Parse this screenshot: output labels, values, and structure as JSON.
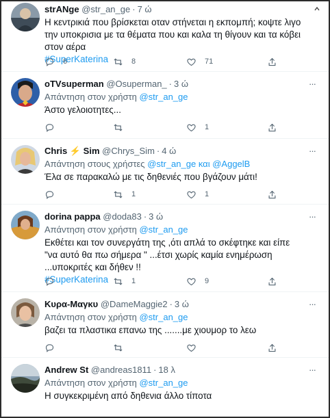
{
  "tweets": [
    {
      "name": "strANge",
      "handle": "@str_an_ge",
      "time": "7 ώ",
      "reply_prefix": "",
      "reply_mentions": [],
      "text": "Η κεντρικιά που βρίσκεται οταν στήνεται η εκπομπή; κοψτε λιγο την υποκρισια με τα θέματα που και καλα τη θίγουν και τα κόβει στον αέρα",
      "hashtag": "#SuperKaterina",
      "counts": {
        "reply": "6",
        "retweet": "8",
        "like": "71"
      }
    },
    {
      "name": "oTVsuperman",
      "handle": "@Osuperman_",
      "time": "3 ώ",
      "reply_prefix": "Απάντηση στον χρήστη",
      "reply_mentions": [
        "@str_an_ge"
      ],
      "text": "Άστο γελοιοτητες...",
      "hashtag": "",
      "counts": {
        "reply": "",
        "retweet": "",
        "like": "1"
      }
    },
    {
      "name": "Chris",
      "name_emoji": "⚡",
      "name_suffix": "Sim",
      "handle": "@Chrys_Sim",
      "time": "4 ώ",
      "reply_prefix": "Απάντηση στους χρήστες",
      "reply_mentions": [
        "@str_an_ge",
        "@AggelB"
      ],
      "reply_joiner": "και",
      "text": "Έλα σε παρακαλώ με τις δηθενιές που βγάζουν μάτι!",
      "hashtag": "",
      "counts": {
        "reply": "",
        "retweet": "1",
        "like": "1"
      }
    },
    {
      "name": "dorina pappa",
      "handle": "@doda83",
      "time": "3 ώ",
      "reply_prefix": "Απάντηση στον χρήστη",
      "reply_mentions": [
        "@str_an_ge"
      ],
      "text": "Εκθέτει και τον συνεργάτη της ,ότι απλά το σκέφτηκε και είπε \"να αυτό θα πω σήμερα \" ...έτσι χωρίς καμία ενημέρωση ...υποκριτές και δήθεν !!",
      "hashtag": "#SuperKaterina",
      "counts": {
        "reply": "",
        "retweet": "1",
        "like": "9"
      }
    },
    {
      "name": "Κυρα-Μαγκυ",
      "handle": "@DameMaggie2",
      "time": "3 ώ",
      "reply_prefix": "Απάντηση στον χρήστη",
      "reply_mentions": [
        "@str_an_ge"
      ],
      "text": "βαζει τα πλαστικα επανω της .......με χιουμορ το λεω",
      "hashtag": "",
      "counts": {
        "reply": "",
        "retweet": "",
        "like": ""
      }
    },
    {
      "name": "Andrew St",
      "handle": "@andreas1811",
      "time": "18 λ",
      "reply_prefix": "Απάντηση στον χρήστη",
      "reply_mentions": [
        "@str_an_ge"
      ],
      "text": "Η συγκεκριμένη από δηθενια άλλο τίποτα",
      "hashtag": "",
      "counts": {
        "reply": "",
        "retweet": "",
        "like": ""
      }
    }
  ],
  "colors": {
    "link": "#1d9bf0",
    "muted": "#536471",
    "text": "#0f1419",
    "divider": "#eff3f4"
  }
}
